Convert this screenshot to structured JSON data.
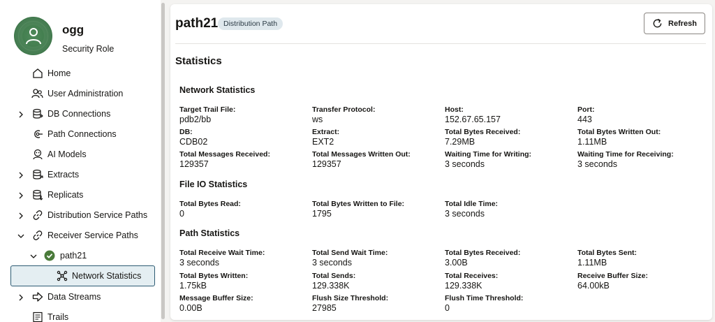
{
  "user": {
    "name": "ogg",
    "role": "Security Role"
  },
  "nav": {
    "items": [
      {
        "label": "Home"
      },
      {
        "label": "User Administration"
      },
      {
        "label": "DB Connections"
      },
      {
        "label": "Path Connections"
      },
      {
        "label": "AI Models"
      },
      {
        "label": "Extracts"
      },
      {
        "label": "Replicats"
      },
      {
        "label": "Distribution Service Paths"
      },
      {
        "label": "Receiver Service Paths"
      },
      {
        "label": "path21"
      },
      {
        "label": "Network Statistics"
      },
      {
        "label": "Data Streams"
      },
      {
        "label": "Trails"
      }
    ]
  },
  "header": {
    "title": "path21",
    "badge": "Distribution Path",
    "refresh_label": "Refresh"
  },
  "statistics": {
    "title": "Statistics",
    "network": {
      "title": "Network Statistics",
      "items": [
        {
          "label": "Target Trail File:",
          "value": "pdb2/bb"
        },
        {
          "label": "Transfer Protocol:",
          "value": "ws"
        },
        {
          "label": "Host:",
          "value": "152.67.65.157"
        },
        {
          "label": "Port:",
          "value": "443"
        },
        {
          "label": "DB:",
          "value": "CDB02"
        },
        {
          "label": "Extract:",
          "value": "EXT2"
        },
        {
          "label": "Total Bytes Received:",
          "value": "7.29MB"
        },
        {
          "label": "Total Bytes Written Out:",
          "value": "1.11MB"
        },
        {
          "label": "Total Messages Received:",
          "value": "129357"
        },
        {
          "label": "Total Messages Written Out:",
          "value": "129357"
        },
        {
          "label": "Waiting Time for Writing:",
          "value": "3 seconds"
        },
        {
          "label": "Waiting Time for Receiving:",
          "value": "3 seconds"
        }
      ]
    },
    "fileio": {
      "title": "File IO Statistics",
      "items": [
        {
          "label": "Total Bytes Read:",
          "value": "0"
        },
        {
          "label": "Total Bytes Written to File:",
          "value": "1795"
        },
        {
          "label": "Total Idle Time:",
          "value": "3 seconds"
        }
      ]
    },
    "path": {
      "title": "Path Statistics",
      "items": [
        {
          "label": "Total Receive Wait Time:",
          "value": "3 seconds"
        },
        {
          "label": "Total Send Wait Time:",
          "value": "3 seconds"
        },
        {
          "label": "Total Bytes Received:",
          "value": "3.00B"
        },
        {
          "label": "Total Bytes Sent:",
          "value": "1.11MB"
        },
        {
          "label": "Total Bytes Written:",
          "value": "1.75kB"
        },
        {
          "label": "Total Sends:",
          "value": "129.338K"
        },
        {
          "label": "Total Receives:",
          "value": "129.338K"
        },
        {
          "label": "Receive Buffer Size:",
          "value": "64.00kB"
        },
        {
          "label": "Message Buffer Size:",
          "value": "0.00B"
        },
        {
          "label": "Flush Size Threshold:",
          "value": "27985"
        },
        {
          "label": "Flush Time Threshold:",
          "value": "0"
        }
      ]
    }
  }
}
